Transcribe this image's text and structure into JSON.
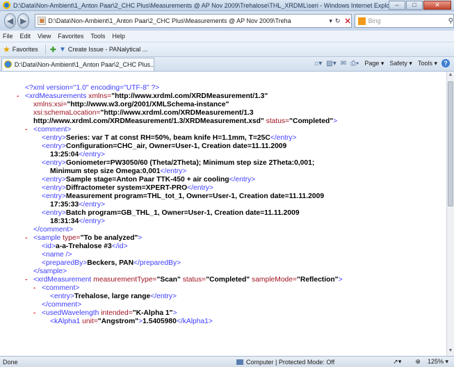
{
  "window": {
    "title": "D:\\Data\\Non-Ambient\\1_Anton Paar\\2_CHC Plus\\Measurements @ AP Nov 2009\\Trehalose\\THL_XRDML\\seri - Windows Internet Explorer"
  },
  "navigation": {
    "address": "D:\\Data\\Non-Ambient\\1_Anton Paar\\2_CHC Plus\\Measurements @ AP Nov 2009\\Treha",
    "search_placeholder": "Bing"
  },
  "menu": [
    "File",
    "Edit",
    "View",
    "Favorites",
    "Tools",
    "Help"
  ],
  "favorites": {
    "label": "Favorites",
    "create_issue": "Create Issue - PANalytical ..."
  },
  "tab": {
    "label": "D:\\Data\\Non-Ambient\\1_Anton Paar\\2_CHC Plus..."
  },
  "command_bar": {
    "page": "Page",
    "safety": "Safety",
    "tools": "Tools"
  },
  "xml": {
    "decl": "<?xml version=\"1.0\" encoding=\"UTF-8\" ?>",
    "root_open": "<xrdMeasurements",
    "xmlns_attr": "xmlns=",
    "xmlns_val": "\"http://www.xrdml.com/XRDMeasurement/1.3\"",
    "xsi_attr": "xmlns:xsi=",
    "xsi_val": "\"http://www.w3.org/2001/XMLSchema-instance\"",
    "schema_attr": "xsi:schemaLocation=",
    "schema_val1": "\"http://www.xrdml.com/XRDMeasurement/1.3",
    "schema_val2": "http://www.xrdml.com/XRDMeasurement/1.3/XRDMeasurement.xsd\"",
    "status_attr": "status=",
    "status_val": "\"Completed\"",
    "comment_open": "<comment>",
    "comment_close": "</comment>",
    "entry_open": "<entry>",
    "entry_close": "</entry>",
    "entries": {
      "e1": "Series: var T at const RH=50%, beam knife H=1.1mm, T=25C",
      "e2a": "Configuration=CHC_air, Owner=User-1, Creation date=11.11.2009",
      "e2b": "13:25:04",
      "e3a": "Goniometer=PW3050/60 (Theta/2Theta); Minimum step size 2Theta:0,001;",
      "e3b": "Minimum step size Omega:0,001",
      "e4": "Sample stage=Anton Paar TTK-450 + air cooling",
      "e5": "Diffractometer system=XPERT-PRO",
      "e6a": "Measurement program=THL_tot_1, Owner=User-1, Creation date=11.11.2009",
      "e6b": "17:35:33",
      "e7a": "Batch program=GB_THL_1, Owner=User-1, Creation date=11.11.2009",
      "e7b": "18:31:34"
    },
    "sample_open": "<sample",
    "sample_type_attr": "type=",
    "sample_type_val": "\"To be analyzed\"",
    "id_open": "<id>",
    "id_val": "a-a-Trehalose #3",
    "id_close": "</id>",
    "name_empty": "<name />",
    "preparedby_open": "<preparedBy>",
    "preparedby_val": "Beckers, PAN",
    "preparedby_close": "</preparedBy>",
    "sample_close": "</sample>",
    "meas_open": "<xrdMeasurement",
    "meas_type_attr": "measurementType=",
    "meas_type_val": "\"Scan\"",
    "meas_status_attr": "status=",
    "meas_status_val": "\"Completed\"",
    "meas_mode_attr": "sampleMode=",
    "meas_mode_val": "\"Reflection\"",
    "meas_comment": "Trehalose, large range",
    "wl_open": "<usedWavelength",
    "wl_attr": "intended=",
    "wl_val": "\"K-Alpha 1\"",
    "ka1_open": "<kAlpha1",
    "ka1_attr": "unit=",
    "ka1_unit": "\"Angstrom\"",
    "ka1_value": "1.5405980",
    "ka1_close": "</kAlpha1>",
    "gt": ">",
    "minus": "-"
  },
  "status": {
    "done": "Done",
    "zone": "Computer | Protected Mode: Off",
    "zoom": "125%"
  }
}
